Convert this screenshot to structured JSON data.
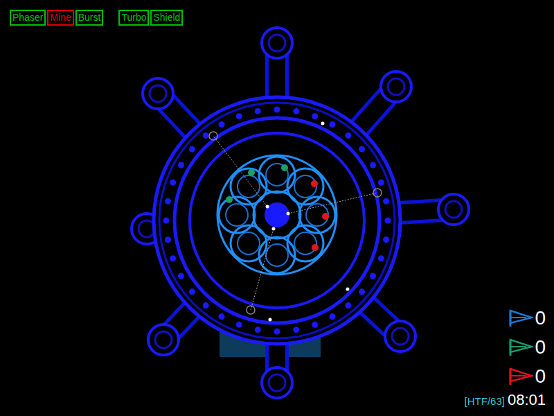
{
  "hud": {
    "weapons": [
      {
        "label": "Phaser",
        "ready": true
      },
      {
        "label": "Mine",
        "ready": false
      },
      {
        "label": "Burst",
        "ready": true
      }
    ],
    "modules": [
      {
        "label": "Turbo",
        "ready": true
      },
      {
        "label": "Shield",
        "ready": true
      }
    ]
  },
  "map": {
    "flags": [
      {
        "color": "#1aa06a"
      },
      {
        "color": "#1aa06a"
      },
      {
        "color": "#1aa06a"
      },
      {
        "color": "#e01818"
      },
      {
        "color": "#e01818"
      },
      {
        "color": "#e01818"
      }
    ]
  },
  "scores": [
    {
      "score": "0",
      "color": "#1e78d2"
    },
    {
      "score": "0",
      "color": "#1a9a70"
    },
    {
      "score": "0",
      "color": "#e0141e"
    }
  ],
  "game_type": "[HTF/63]",
  "timer": "08:01"
}
